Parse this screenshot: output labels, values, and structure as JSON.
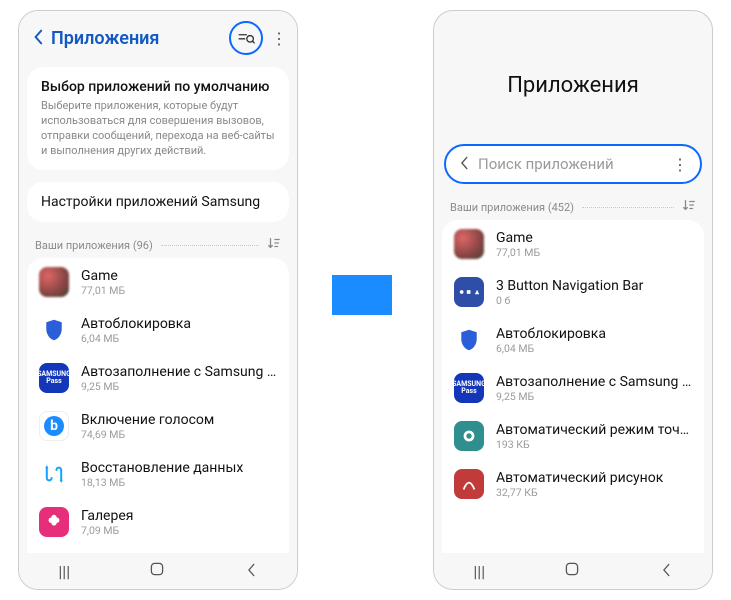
{
  "left": {
    "header_title": "Приложения",
    "card1": {
      "title": "Выбор приложений по умолчанию",
      "desc": "Выберите приложения, которые будут использоваться для совершения вызовов, отправки сообщений, перехода на веб-сайты и выполнения других действий."
    },
    "card2": "Настройки приложений Samsung",
    "section": "Ваши приложения (96)",
    "apps": [
      {
        "name": "Game",
        "size": "77,01 МБ"
      },
      {
        "name": "Автоблокировка",
        "size": "6,04 МБ"
      },
      {
        "name": "Автозаполнение с Samsung P..",
        "size": "9,25 МБ"
      },
      {
        "name": "Включение голосом",
        "size": "74,69 МБ"
      },
      {
        "name": "Восстановление данных",
        "size": "18,13 МБ"
      },
      {
        "name": "Галерея",
        "size": "7,09 МБ"
      }
    ]
  },
  "right": {
    "big_title": "Приложения",
    "search_placeholder": "Поиск приложений",
    "section": "Ваши приложения (452)",
    "apps": [
      {
        "name": "Game",
        "size": "77,01 МБ"
      },
      {
        "name": "3 Button Navigation Bar",
        "size": "0 б"
      },
      {
        "name": "Автоблокировка",
        "size": "6,04 МБ"
      },
      {
        "name": "Автозаполнение с Samsung P..",
        "size": "9,25 МБ"
      },
      {
        "name": "Автоматический режим точки..",
        "size": "193 КБ"
      },
      {
        "name": "Автоматический рисунок",
        "size": "32,77 КБ"
      }
    ]
  }
}
